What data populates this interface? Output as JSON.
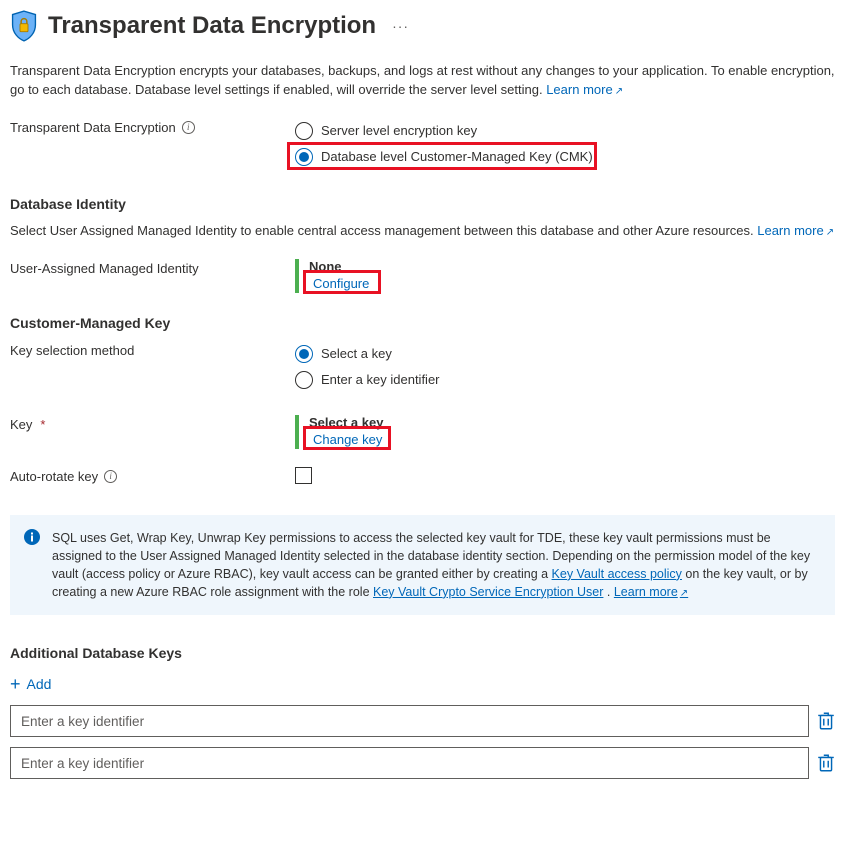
{
  "header": {
    "title": "Transparent Data Encryption"
  },
  "intro": {
    "text": "Transparent Data Encryption encrypts your databases, backups, and logs at rest without any changes to your application. To enable encryption, go to each database. Database level settings if enabled, will override the server level setting. ",
    "learn_more": "Learn more"
  },
  "tde": {
    "label": "Transparent Data Encryption",
    "option_server": "Server level encryption key",
    "option_db_cmk": "Database level Customer-Managed Key (CMK)"
  },
  "identity_section": {
    "heading": "Database Identity",
    "desc": "Select User Assigned Managed Identity to enable central access management between this database and other Azure resources. ",
    "learn_more": "Learn more",
    "uami_label": "User-Assigned Managed Identity",
    "uami_value": "None",
    "configure": "Configure"
  },
  "cmk_section": {
    "heading": "Customer-Managed Key",
    "method_label": "Key selection method",
    "method_select": "Select a key",
    "method_identifier": "Enter a key identifier",
    "key_label": "Key",
    "key_value": "Select a key",
    "change_key": "Change key",
    "autorotate_label": "Auto-rotate key"
  },
  "note": {
    "part1": "SQL uses Get, Wrap Key, Unwrap Key permissions to access the selected key vault for TDE, these key vault permissions must be assigned to the User Assigned Managed Identity selected in the database identity section. Depending on the permission model of the key vault (access policy or Azure RBAC), key vault access can be granted either by creating a ",
    "link1": "Key Vault access policy",
    "part2": " on the key vault, or by creating a new Azure RBAC role assignment with the role ",
    "link2": "Key Vault Crypto Service Encryption User",
    "part3": ". ",
    "learn_more": "Learn more"
  },
  "additional": {
    "heading": "Additional Database Keys",
    "add_label": "Add",
    "placeholder": "Enter a key identifier"
  }
}
